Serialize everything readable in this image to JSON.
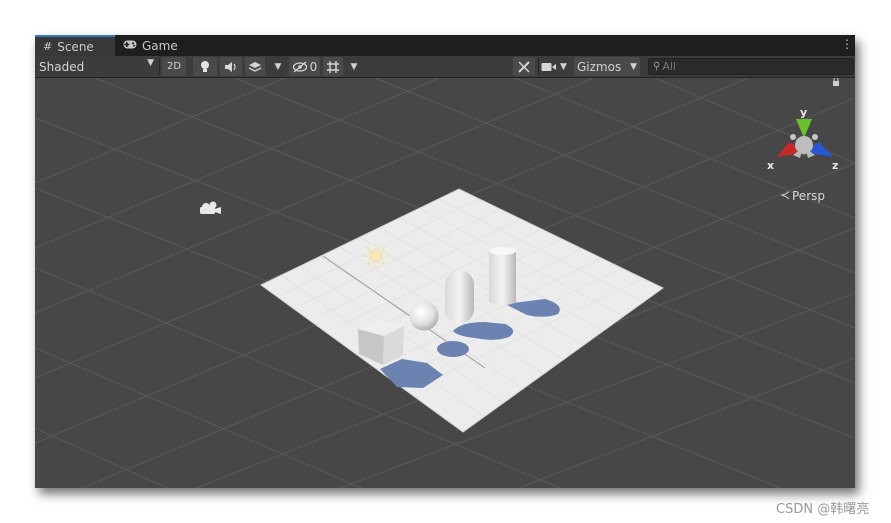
{
  "tabs": [
    {
      "label": "Scene",
      "icon": "grid-icon"
    },
    {
      "label": "Game",
      "icon": "gamepad-icon"
    }
  ],
  "toolbar": {
    "shading_mode": "Shaded",
    "two_d_label": "2D",
    "hidden_count": "0",
    "gizmos_label": "Gizmos",
    "search_placeholder": "All"
  },
  "gizmo": {
    "y_label": "y",
    "x_label": "x",
    "z_label": "z",
    "projection_label": "Persp",
    "y_color": "#6ac12d",
    "x_color": "#c8282a",
    "z_color": "#2a58d4"
  },
  "scene": {
    "objects": [
      "cube",
      "sphere",
      "capsule",
      "cylinder",
      "plane"
    ],
    "light": "directional-light",
    "camera": "camera"
  },
  "watermark": "CSDN @韩曙亮"
}
